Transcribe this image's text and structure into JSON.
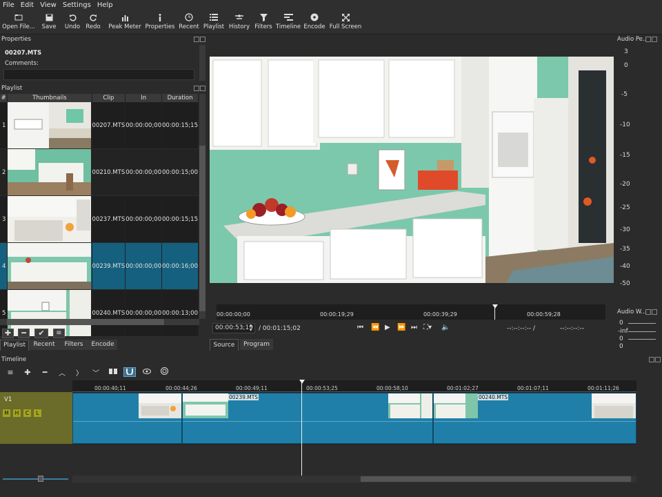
{
  "menu": [
    "File",
    "Edit",
    "View",
    "Settings",
    "Help"
  ],
  "toolbar": [
    {
      "label": "Open File...",
      "icon": "open-file-icon"
    },
    {
      "label": "Save",
      "icon": "save-icon"
    },
    {
      "label": "Undo",
      "icon": "undo-icon"
    },
    {
      "label": "Redo",
      "icon": "redo-icon"
    },
    {
      "label": "Peak Meter",
      "icon": "peak-meter-icon"
    },
    {
      "label": "Properties",
      "icon": "properties-icon"
    },
    {
      "label": "Recent",
      "icon": "recent-icon"
    },
    {
      "label": "Playlist",
      "icon": "playlist-icon"
    },
    {
      "label": "History",
      "icon": "history-icon"
    },
    {
      "label": "Filters",
      "icon": "filters-icon"
    },
    {
      "label": "Timeline",
      "icon": "timeline-icon"
    },
    {
      "label": "Encode",
      "icon": "encode-icon"
    },
    {
      "label": "Full Screen",
      "icon": "full-screen-icon"
    }
  ],
  "properties": {
    "title": "Properties",
    "filename": "00207.MTS",
    "comments_label": "Comments:"
  },
  "playlist": {
    "title": "Playlist",
    "columns": [
      "#",
      "Thumbnails",
      "Clip",
      "In",
      "Duration"
    ],
    "rows": [
      {
        "num": "1",
        "clip": "00207.MTS",
        "in": "00:00:00;00",
        "duration": "00:00:15;15"
      },
      {
        "num": "2",
        "clip": "00210.MTS",
        "in": "00:00:00;00",
        "duration": "00:00:15;00"
      },
      {
        "num": "3",
        "clip": "00237.MTS",
        "in": "00:00:00;00",
        "duration": "00:00:15;15"
      },
      {
        "num": "4",
        "clip": "00239.MTS",
        "in": "00:00:00;00",
        "duration": "00:00:16;00"
      },
      {
        "num": "5",
        "clip": "00240.MTS",
        "in": "00:00:00;00",
        "duration": "00:00:13;00"
      }
    ],
    "selected_row": 4,
    "tabs": [
      "Playlist",
      "Recent",
      "Filters",
      "Encode"
    ]
  },
  "player": {
    "ruler": [
      "00:00:00;00",
      "00:00:19;29",
      "00:00:39;29",
      "00:00:59;28"
    ],
    "position": "00:00:53;19",
    "duration": "/ 00:01:15;02",
    "in_point": "--:--:--:-- /",
    "out_point": "--:--:--:--",
    "tabs": [
      "Source",
      "Program"
    ]
  },
  "audio_peak": {
    "title": "Audio Pe...",
    "scale": [
      "3",
      "0",
      "-5",
      "-10",
      "-15",
      "-20",
      "-25",
      "-30",
      "-35",
      "-40",
      "-50"
    ]
  },
  "audio_waveform": {
    "title": "Audio W...",
    "labels": [
      "0",
      "-inf",
      "0",
      "0"
    ]
  },
  "timeline": {
    "title": "Timeline",
    "ticks": [
      "00:00:40;11",
      "00:00:44;26",
      "00:00:49;11",
      "00:00:53;25",
      "00:00:58;10",
      "00:01:02;27",
      "00:01:07;11",
      "00:01:11;26"
    ],
    "track_name": "V1",
    "track_buttons": [
      "M",
      "H",
      "C",
      "L"
    ],
    "clips": [
      {
        "label": ""
      },
      {
        "label": "00239.MTS"
      },
      {
        "label": "00240.MTS"
      }
    ]
  }
}
